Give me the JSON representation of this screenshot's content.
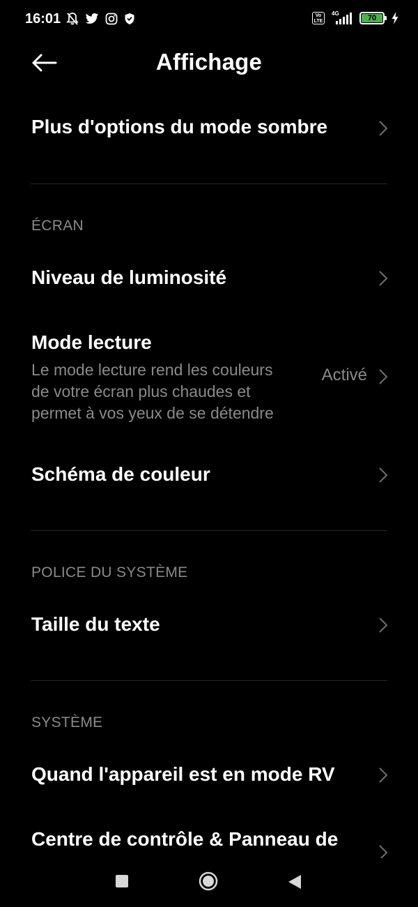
{
  "status_bar": {
    "time": "16:01",
    "network": "4G",
    "volte": "Vo LTE",
    "battery": "70",
    "left_icons": [
      "bell-off-icon",
      "twitter-icon",
      "instagram-icon",
      "shield-icon"
    ],
    "right_icons": [
      "volte-icon",
      "signal-icon",
      "battery-icon",
      "charging-icon"
    ]
  },
  "header": {
    "title": "Affichage",
    "back_icon": "arrow-left-icon"
  },
  "rows": {
    "dark_mode_options": {
      "title": "Plus d'options du mode sombre"
    },
    "brightness": {
      "title": "Niveau de luminosité"
    },
    "reading_mode": {
      "title": "Mode lecture",
      "description_line1": "Le mode lecture rend les couleurs",
      "description_line2": "de votre écran plus chaudes et",
      "description_line3": "permet à vos yeux de se détendre",
      "value": "Activé"
    },
    "color_scheme": {
      "title": "Schéma de couleur"
    },
    "text_size": {
      "title": "Taille du texte"
    },
    "vr_mode": {
      "title": "Quand l'appareil est en mode RV"
    },
    "control_center": {
      "title": "Centre de contrôle & Panneau de"
    }
  },
  "sections": {
    "screen": "ÉCRAN",
    "system_font": "POLICE DU SYSTÈME",
    "system": "SYSTÈME"
  },
  "nav_bar": {
    "icons": [
      "recents-square-icon",
      "home-circle-icon",
      "back-triangle-icon"
    ]
  },
  "colors": {
    "background": "#000000",
    "primary_text": "#ffffff",
    "secondary_text": "#8a8a8a",
    "divider": "#262626",
    "battery_fill": "#4caf50"
  }
}
